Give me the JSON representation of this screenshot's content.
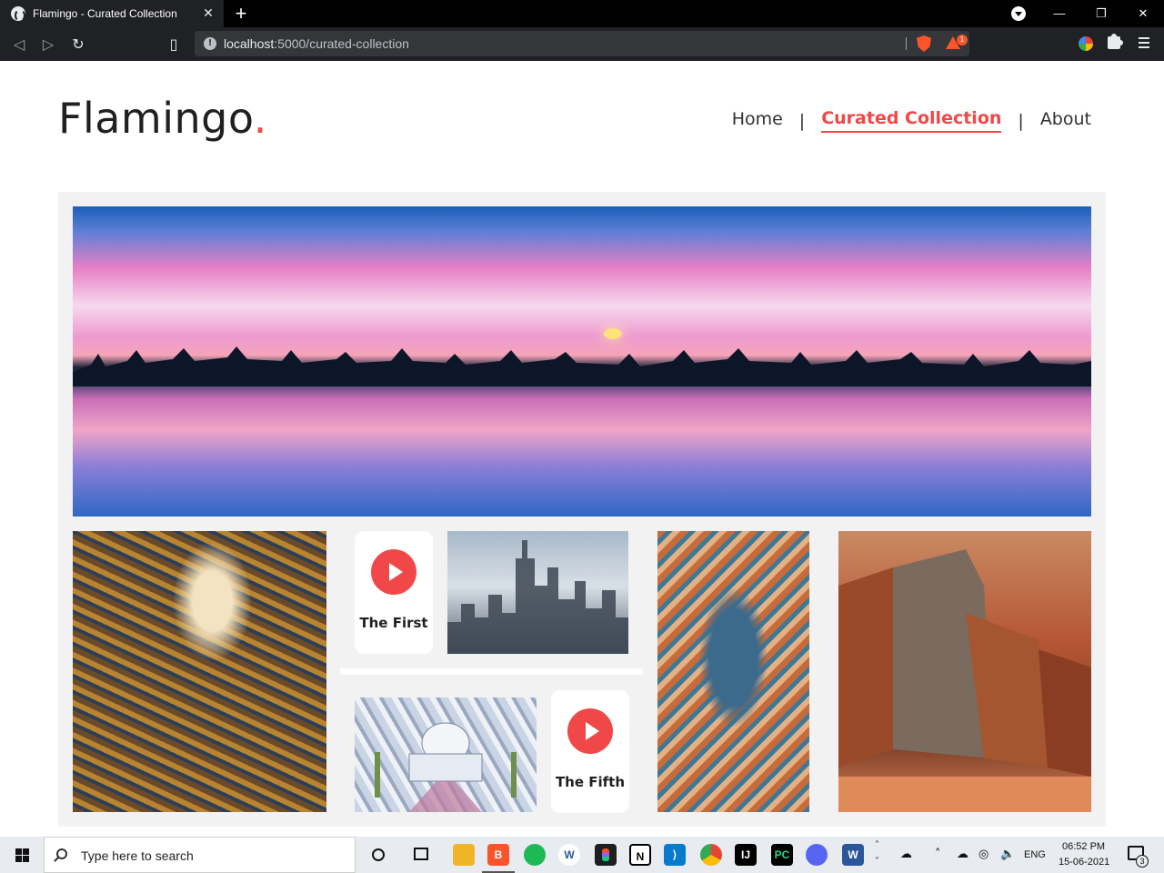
{
  "browser": {
    "tab_title": "Flamingo - Curated Collection",
    "tab_close": "✕",
    "new_tab": "+",
    "url_host": "localhost",
    "url_path": ":5000/curated-collection",
    "rewards_count": "1",
    "window_controls": {
      "minimize": "—",
      "maximize": "❐",
      "close": "✕"
    }
  },
  "site": {
    "logo_text": "Flamingo",
    "logo_dot": ".",
    "accent_color": "#f04848",
    "nav": [
      {
        "label": "Home",
        "active": false
      },
      {
        "label": "Curated Collection",
        "active": true
      },
      {
        "label": "About",
        "active": false
      }
    ],
    "nav_separator": "|"
  },
  "gallery": {
    "play_cards": [
      {
        "label": "The First"
      },
      {
        "label": "The Fifth"
      }
    ]
  },
  "taskbar": {
    "search_placeholder": "Type here to search",
    "language": "ENG",
    "time": "06:52 PM",
    "date": "15-06-2021",
    "notification_count": "3",
    "apps": [
      "file-explorer",
      "brave",
      "spotify",
      "word-online",
      "figma",
      "notion",
      "vscode",
      "chrome",
      "intellij",
      "pycharm",
      "discord",
      "word"
    ]
  }
}
